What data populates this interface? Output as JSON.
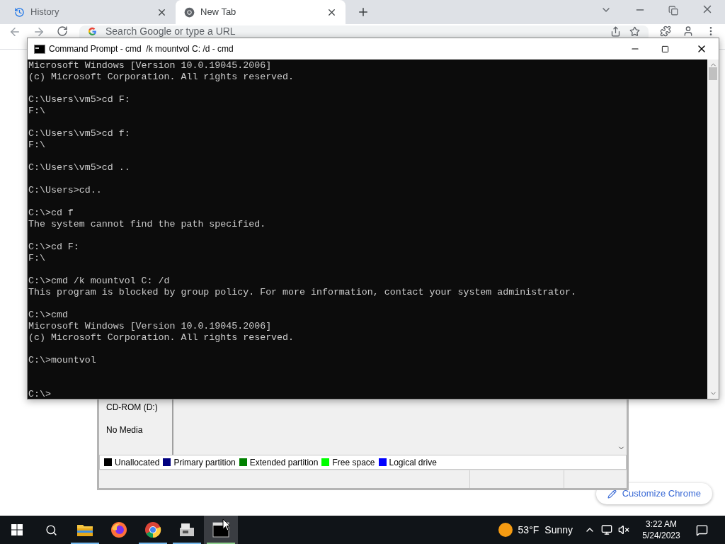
{
  "browser": {
    "tabs": [
      {
        "title": "History",
        "selected": false
      },
      {
        "title": "New Tab",
        "selected": true
      }
    ],
    "omnibox": {
      "placeholder": "Search Google or type a URL"
    },
    "customize_button": "Customize Chrome"
  },
  "disk_management": {
    "volume": {
      "name": "CD-ROM (D:)",
      "status": "No Media"
    },
    "legend": [
      {
        "label": "Unallocated",
        "color": "#000000"
      },
      {
        "label": "Primary partition",
        "color": "#000080"
      },
      {
        "label": "Extended partition",
        "color": "#008000"
      },
      {
        "label": "Free space",
        "color": "#00ff00"
      },
      {
        "label": "Logical drive",
        "color": "#0000ff"
      }
    ]
  },
  "console": {
    "title": "Command Prompt - cmd  /k mountvol C: /d - cmd",
    "lines": [
      {
        "kind": "output",
        "text": "Microsoft Windows [Version 10.0.19045.2006]"
      },
      {
        "kind": "output",
        "text": "(c) Microsoft Corporation. All rights reserved."
      },
      {
        "kind": "blank"
      },
      {
        "kind": "output",
        "text": "C:\\Users\\vm5>cd F:"
      },
      {
        "kind": "output",
        "text": "F:\\"
      },
      {
        "kind": "blank"
      },
      {
        "kind": "output",
        "text": "C:\\Users\\vm5>cd f:"
      },
      {
        "kind": "output",
        "text": "F:\\"
      },
      {
        "kind": "blank"
      },
      {
        "kind": "output",
        "text": "C:\\Users\\vm5>cd .."
      },
      {
        "kind": "blank"
      },
      {
        "kind": "output",
        "text": "C:\\Users>cd.."
      },
      {
        "kind": "blank"
      },
      {
        "kind": "output",
        "text": "C:\\>cd f"
      },
      {
        "kind": "output",
        "text": "The system cannot find the path specified."
      },
      {
        "kind": "blank"
      },
      {
        "kind": "output",
        "text": "C:\\>cd F:"
      },
      {
        "kind": "output",
        "text": "F:\\"
      },
      {
        "kind": "blank"
      },
      {
        "kind": "output",
        "text": "C:\\>cmd /k mountvol C: /d"
      },
      {
        "kind": "output",
        "text": "This program is blocked by group policy. For more information, contact your system administrator."
      },
      {
        "kind": "blank"
      },
      {
        "kind": "output",
        "text": "C:\\>cmd"
      },
      {
        "kind": "output",
        "text": "Microsoft Windows [Version 10.0.19045.2006]"
      },
      {
        "kind": "output",
        "text": "(c) Microsoft Corporation. All rights reserved."
      },
      {
        "kind": "blank"
      },
      {
        "kind": "output",
        "text": "C:\\>mountvol"
      },
      {
        "kind": "blank"
      },
      {
        "kind": "blank"
      },
      {
        "kind": "output",
        "text": "C:\\>"
      }
    ]
  },
  "taskbar": {
    "apps": [
      {
        "kind": "explorer",
        "running": true,
        "selected": false
      },
      {
        "kind": "firefox",
        "running": false,
        "selected": false
      },
      {
        "kind": "chrome",
        "running": true,
        "selected": false
      },
      {
        "kind": "installer",
        "running": true,
        "selected": false
      },
      {
        "kind": "console",
        "running": true,
        "selected": true
      }
    ],
    "weather": {
      "temperature": "53°F",
      "condition": "Sunny"
    },
    "time": "3:22 AM",
    "date": "5/24/2023"
  }
}
